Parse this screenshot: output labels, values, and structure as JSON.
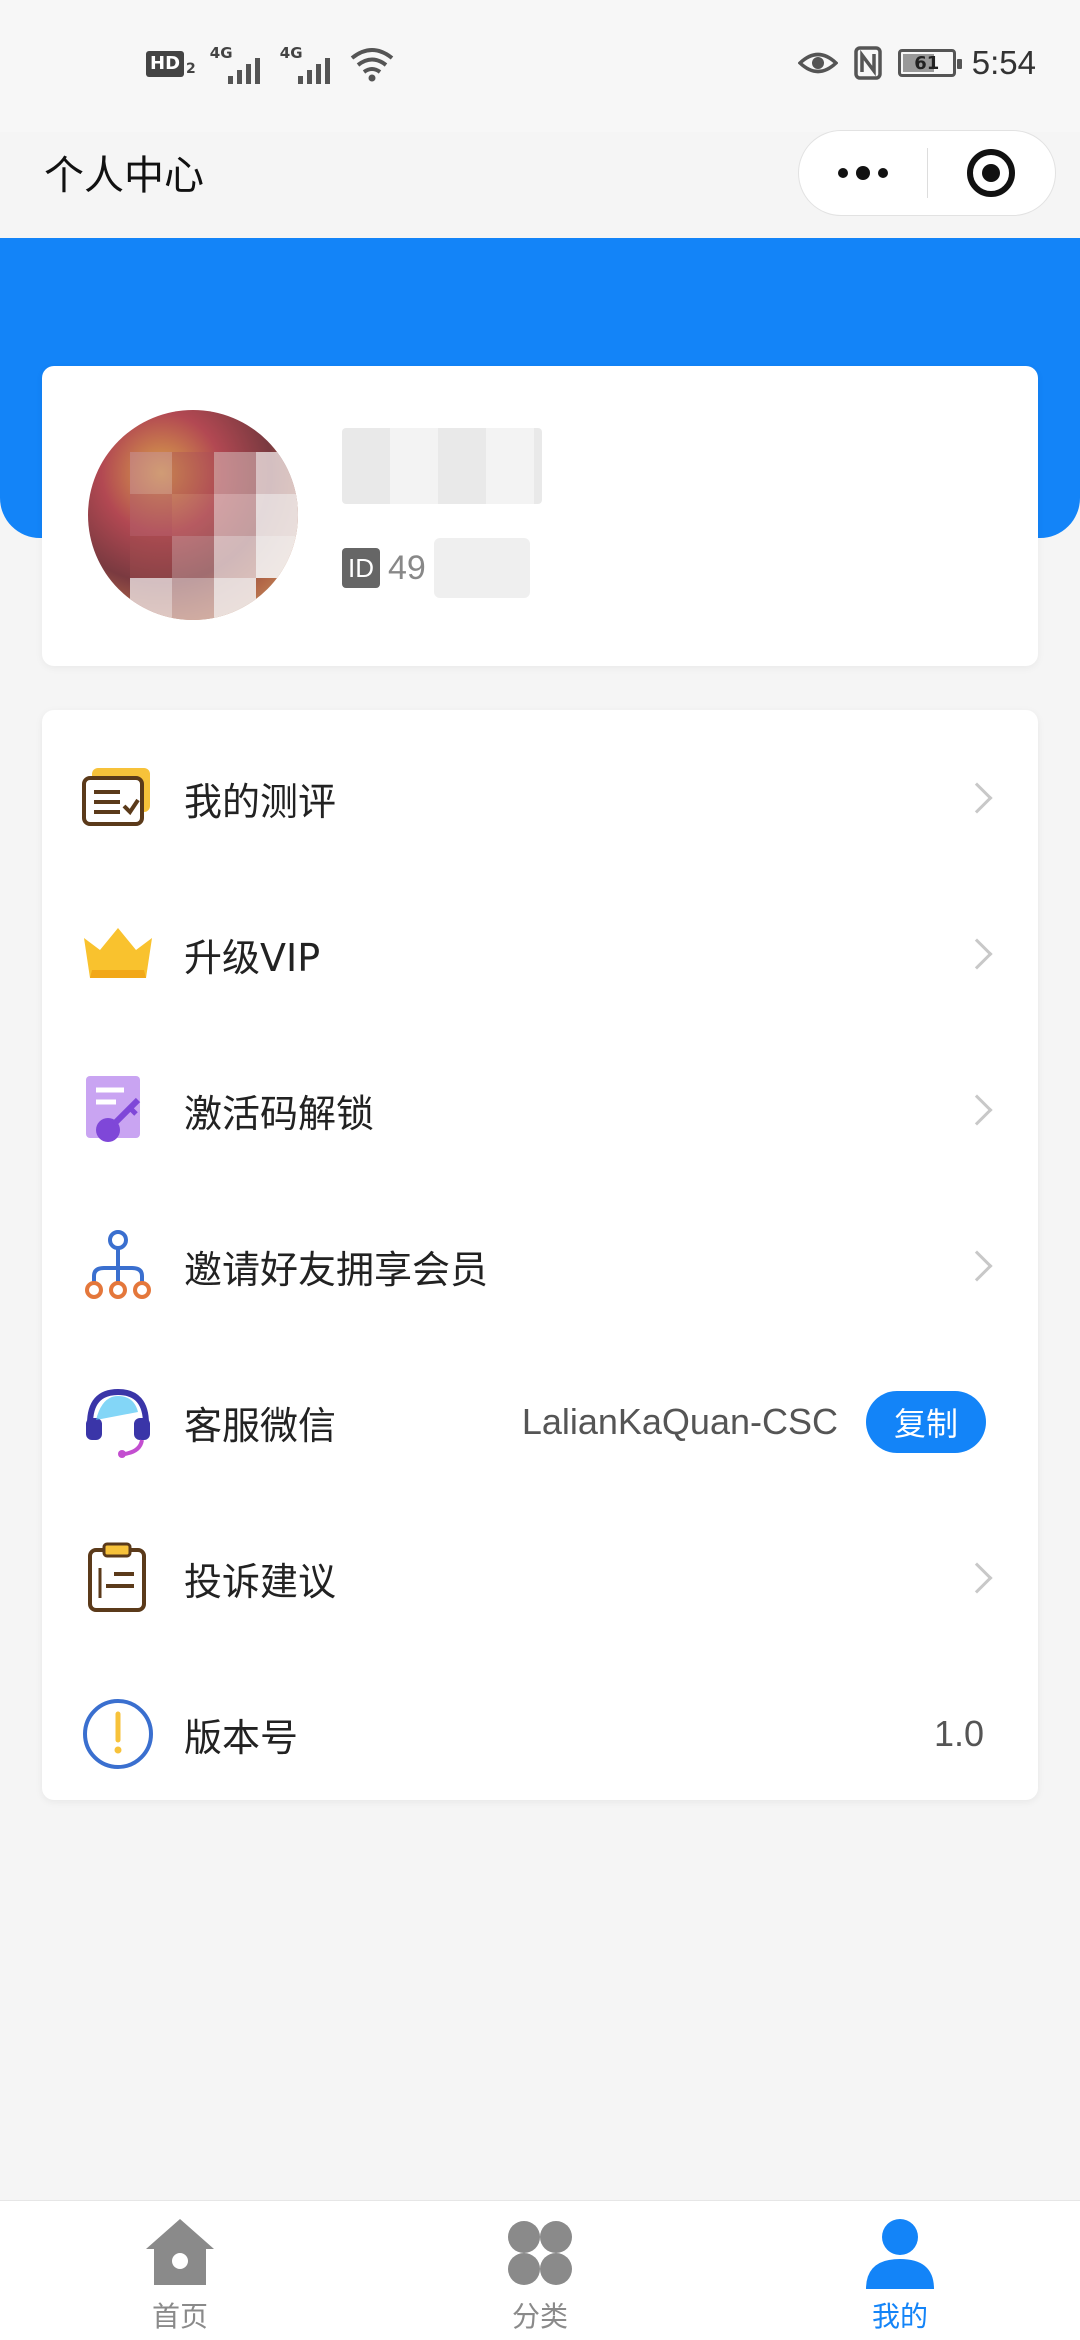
{
  "status_bar": {
    "hd_label": "HD",
    "hd_sub": "2",
    "signal1_label": "4G",
    "signal2_label": "4G",
    "battery_level": "61",
    "time": "5:54"
  },
  "nav": {
    "title": "个人中心"
  },
  "profile": {
    "id_badge": "ID",
    "id_value": "49"
  },
  "menu": {
    "items": [
      {
        "label": "我的测评",
        "icon": "evaluation-icon"
      },
      {
        "label": "升级VIP",
        "icon": "crown-icon"
      },
      {
        "label": "激活码解锁",
        "icon": "activation-code-icon"
      },
      {
        "label": "邀请好友拥享会员",
        "icon": "invite-network-icon"
      },
      {
        "label": "客服微信",
        "icon": "headset-icon",
        "value": "LalianKaQuan-CSC",
        "button": "复制"
      },
      {
        "label": "投诉建议",
        "icon": "clipboard-icon"
      },
      {
        "label": "版本号",
        "icon": "info-icon",
        "value": "1.0"
      }
    ]
  },
  "tabs": [
    {
      "label": "首页",
      "icon": "home-icon",
      "active": false
    },
    {
      "label": "分类",
      "icon": "category-icon",
      "active": false
    },
    {
      "label": "我的",
      "icon": "user-icon",
      "active": true
    }
  ],
  "colors": {
    "accent": "#1384f8",
    "background": "#f5f5f5",
    "inactive_tab": "#8a8a8a"
  }
}
